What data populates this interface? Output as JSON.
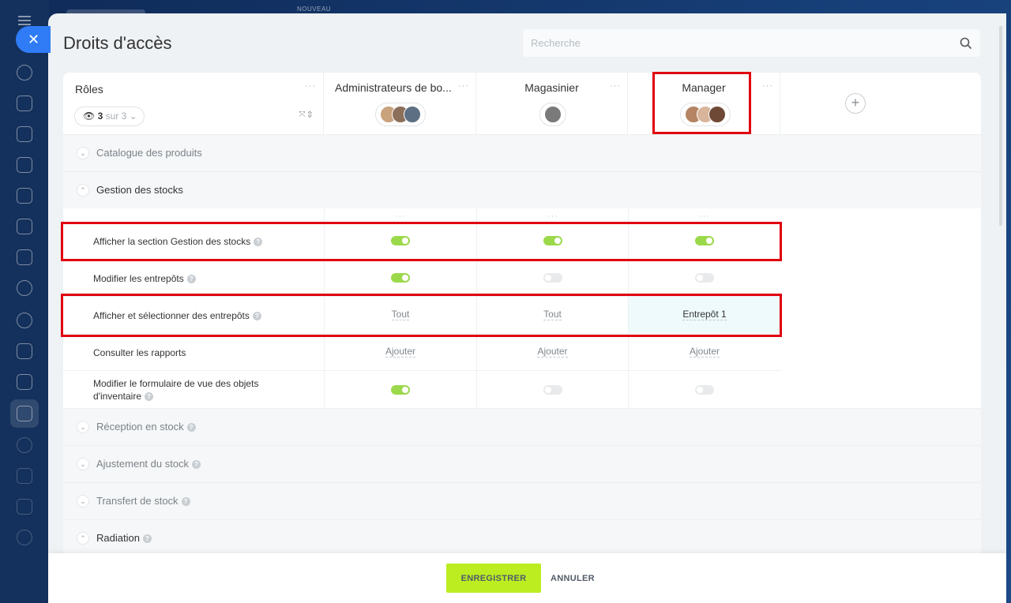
{
  "topbar": {
    "new_label": "NOUVEAU"
  },
  "page": {
    "title": "Droits d'accès",
    "close_symbol": "✕"
  },
  "search": {
    "placeholder": "Recherche",
    "value": ""
  },
  "header": {
    "roles_label": "Rôles",
    "filter_count": "3",
    "filter_suffix": "sur 3",
    "more_symbol": "···",
    "add_symbol": "+"
  },
  "roles": [
    {
      "name": "Administrateurs de bo...",
      "avatars": [
        "#c9a27e",
        "#8c6f5a",
        "#5d6f82"
      ]
    },
    {
      "name": "Magasinier",
      "avatars": [
        "#7a7a7a"
      ]
    },
    {
      "name": "Manager",
      "avatars": [
        "#b48463",
        "#d8b49a",
        "#6e4a36"
      ]
    }
  ],
  "sections": {
    "catalogue": {
      "label": "Catalogue des produits",
      "expanded": false
    },
    "gestion": {
      "label": "Gestion des stocks",
      "expanded": true
    },
    "reception": {
      "label": "Réception en stock",
      "expanded": false
    },
    "ajustement": {
      "label": "Ajustement du stock",
      "expanded": false
    },
    "transfert": {
      "label": "Transfert de stock",
      "expanded": false
    },
    "radiation": {
      "label": "Radiation",
      "expanded": true
    }
  },
  "permissions": {
    "afficher_section": {
      "label": "Afficher la section Gestion des stocks",
      "values": [
        true,
        true,
        true
      ]
    },
    "modifier_entrepots": {
      "label": "Modifier les entrepôts",
      "values": [
        true,
        false,
        false
      ]
    },
    "afficher_entrepots": {
      "label": "Afficher et sélectionner des entrepôts",
      "values": [
        "Tout",
        "Tout",
        "Entrepôt 1"
      ]
    },
    "consulter_rapports": {
      "label": "Consulter les rapports",
      "values": [
        "Ajouter",
        "Ajouter",
        "Ajouter"
      ]
    },
    "modifier_formulaire": {
      "label": "Modifier le formulaire de vue des objets d'inventaire",
      "values": [
        true,
        false,
        false
      ]
    }
  },
  "footer": {
    "save_label": "ENREGISTRER",
    "cancel_label": "ANNULER"
  },
  "colors": {
    "accent": "#bbed21",
    "toggle_on": "#9bd94a",
    "highlight": "#e0000f",
    "close": "#2f7cf6"
  }
}
